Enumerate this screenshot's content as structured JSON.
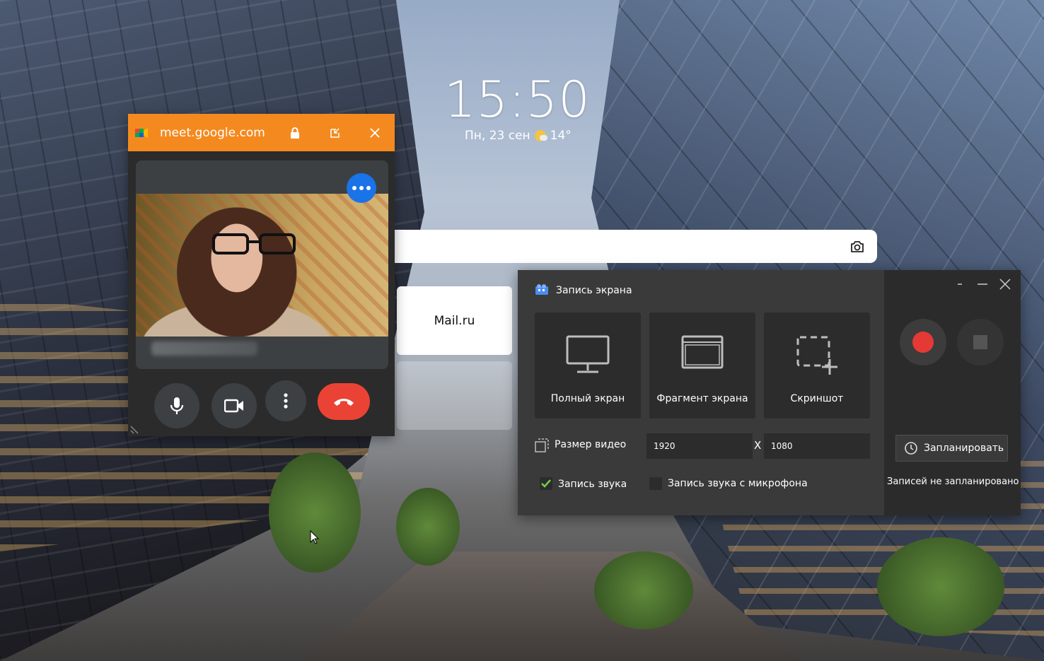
{
  "lockscreen": {
    "time": "15:50",
    "date": "Пн, 23 сен",
    "temperature": "14°",
    "weather_icon": "partly-cloudy-icon"
  },
  "browser": {
    "tiles": [
      {
        "label": "Mail.ru"
      },
      {
        "label": ""
      }
    ]
  },
  "meet": {
    "url": "meet.google.com",
    "title_color": "#f48a1f",
    "hangup_color": "#ea4335",
    "more_button_color": "#1a73e8",
    "controls": [
      "mic-icon",
      "camera-icon",
      "more-vert-icon",
      "hangup-icon"
    ]
  },
  "recorder": {
    "title": "Запись экрана",
    "modes": [
      {
        "label": "Полный экран",
        "icon": "monitor-icon"
      },
      {
        "label": "Фрагмент экрана",
        "icon": "window-icon"
      },
      {
        "label": "Скриншот",
        "icon": "screenshot-icon"
      }
    ],
    "video_size_label": "Размер видео",
    "width_value": "1920",
    "height_value": "1080",
    "times_sign": "X",
    "audio": {
      "label": "Запись звука",
      "checked": true
    },
    "mic_audio": {
      "label": "Запись звука с микрофона",
      "checked": false
    },
    "schedule_button": "Запланировать",
    "schedule_status": "Записей не запланировано",
    "record_color": "#e53935",
    "accent_check": "#6fcf4a"
  }
}
